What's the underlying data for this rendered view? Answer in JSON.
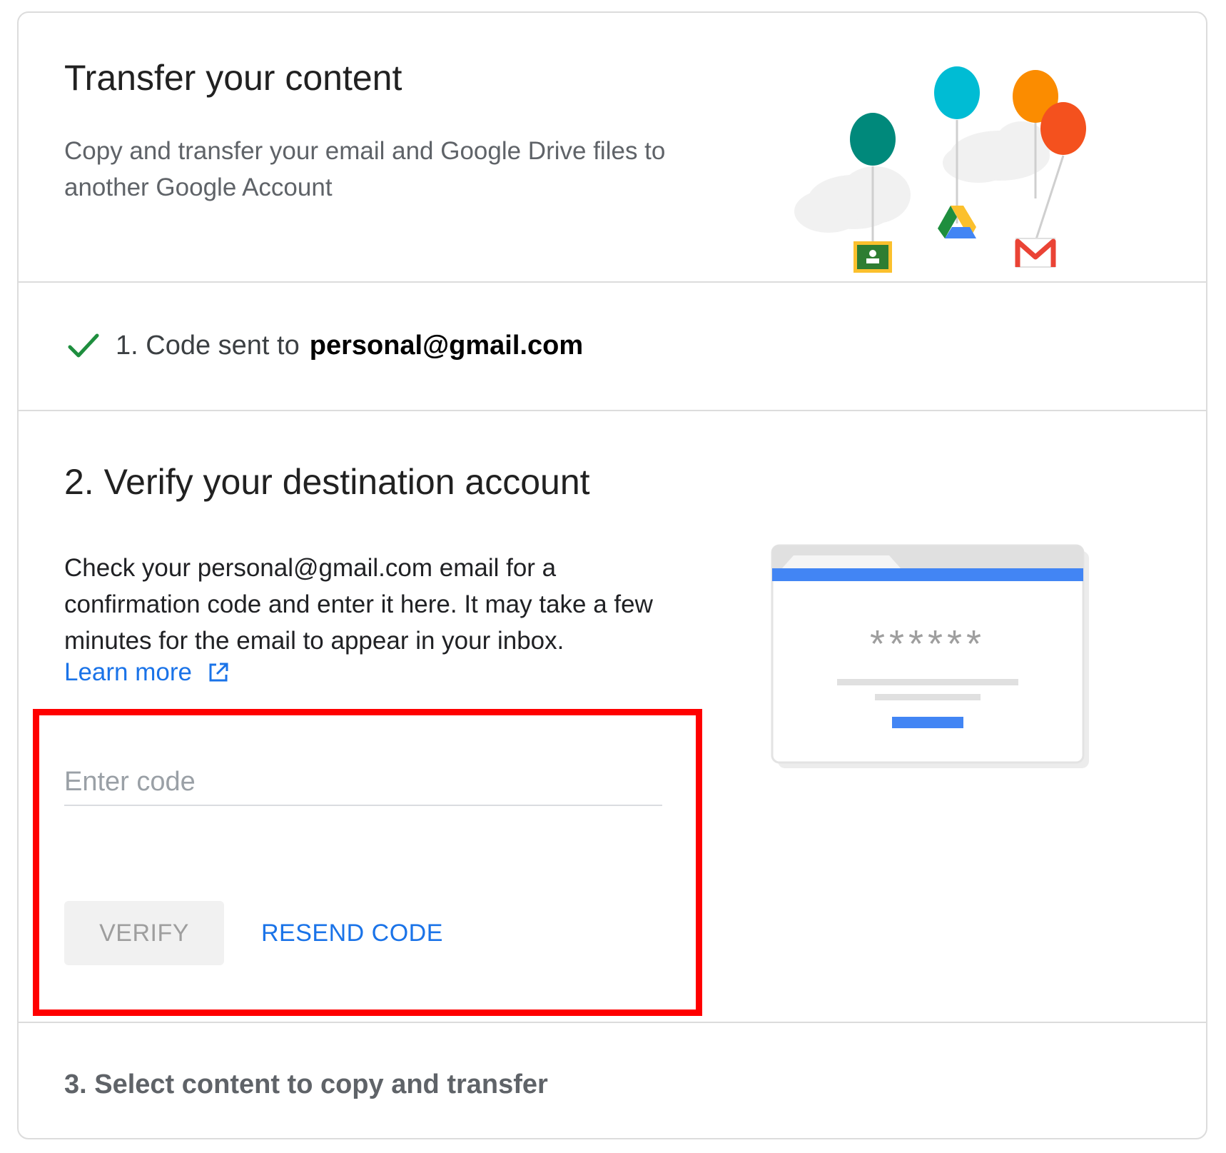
{
  "header": {
    "title": "Transfer your content",
    "subtitle": "Copy and transfer your email and Google Drive files to another Google Account"
  },
  "step1": {
    "label": "1. Code sent to",
    "email": "personal@gmail.com",
    "status_icon": "check-icon"
  },
  "step2": {
    "title": "2. Verify your destination account",
    "instructions": "Check your personal@gmail.com email for a confirmation code and enter it here. It may take a few minutes for the email to appear in your inbox.",
    "learn_more": "Learn more",
    "code_input": {
      "placeholder": "Enter code",
      "value": ""
    },
    "verify_label": "VERIFY",
    "resend_label": "RESEND CODE",
    "illustration_mask": "******"
  },
  "step3": {
    "title": "3. Select content to copy and transfer"
  },
  "colors": {
    "link": "#1a73e8",
    "check": "#1e8e3e",
    "highlight": "#ff0000",
    "browser_bar": "#4285f4"
  }
}
